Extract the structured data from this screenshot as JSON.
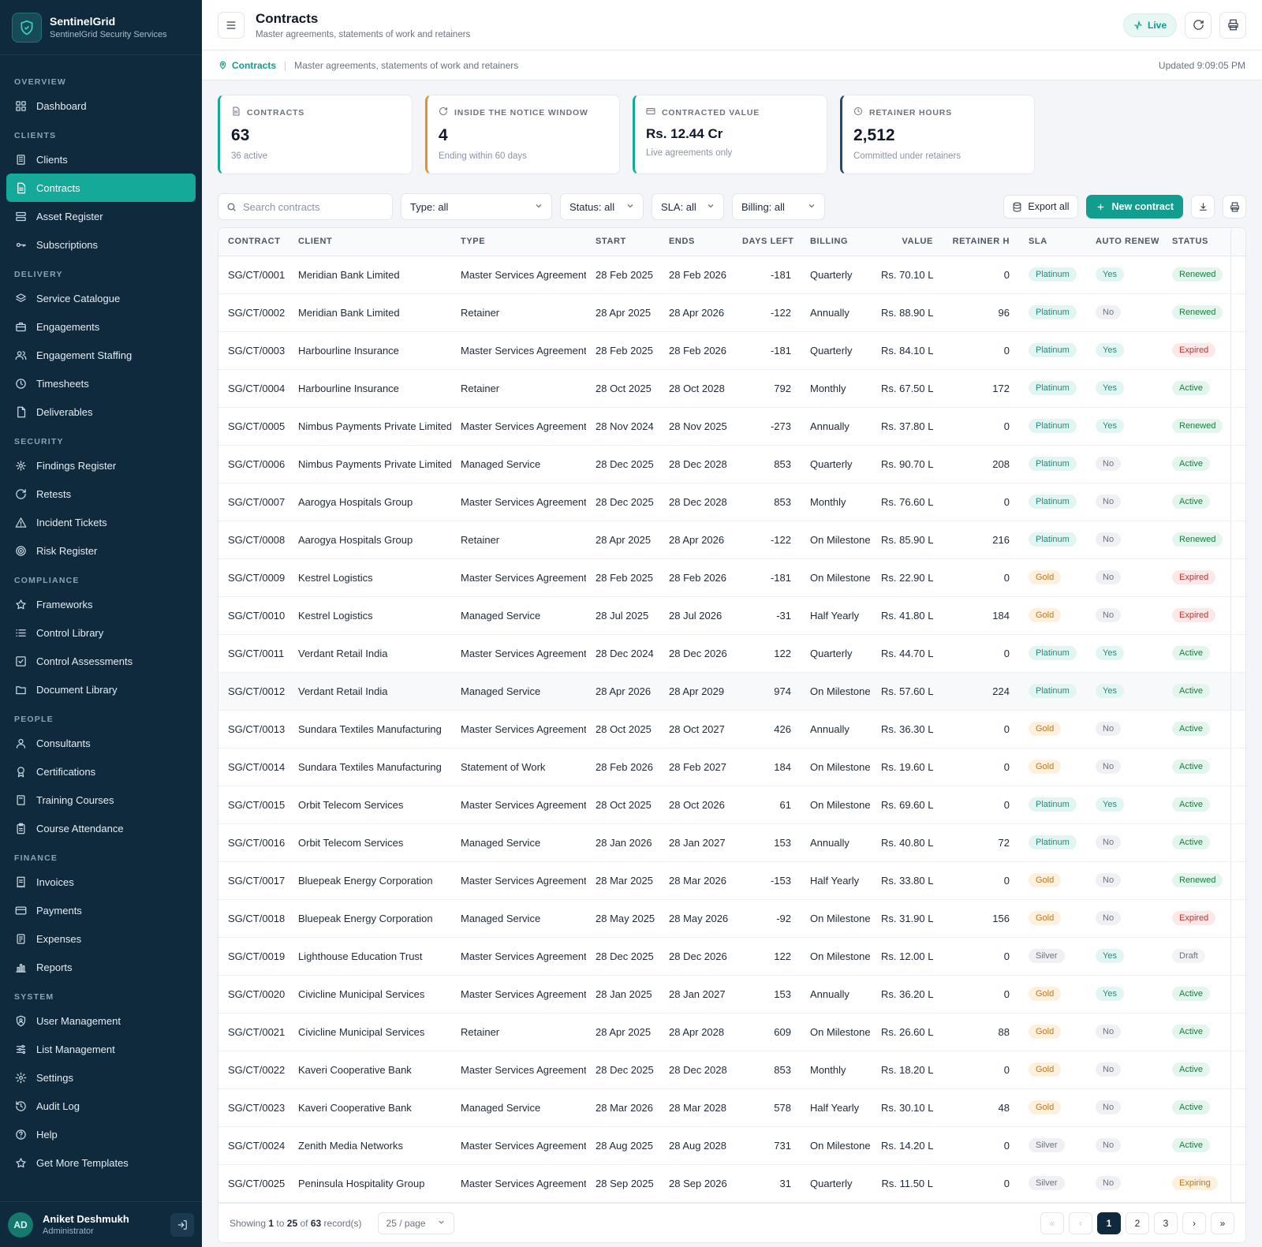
{
  "brand": {
    "name": "SentinelGrid",
    "subtitle": "SentinelGrid Security Services"
  },
  "sidebar": {
    "sections": [
      {
        "label": "OVERVIEW",
        "items": [
          {
            "label": "Dashboard",
            "icon": "dashboard-icon"
          }
        ]
      },
      {
        "label": "CLIENTS",
        "items": [
          {
            "label": "Clients",
            "icon": "building-icon"
          },
          {
            "label": "Contracts",
            "icon": "document-icon",
            "active": true
          },
          {
            "label": "Asset Register",
            "icon": "server-icon"
          },
          {
            "label": "Subscriptions",
            "icon": "key-icon"
          }
        ]
      },
      {
        "label": "DELIVERY",
        "items": [
          {
            "label": "Service Catalogue",
            "icon": "layers-icon"
          },
          {
            "label": "Engagements",
            "icon": "briefcase-icon"
          },
          {
            "label": "Engagement Staffing",
            "icon": "users-icon"
          },
          {
            "label": "Timesheets",
            "icon": "clock-icon"
          },
          {
            "label": "Deliverables",
            "icon": "file-icon"
          }
        ]
      },
      {
        "label": "SECURITY",
        "items": [
          {
            "label": "Findings Register",
            "icon": "bug-icon"
          },
          {
            "label": "Retests",
            "icon": "refresh-icon"
          },
          {
            "label": "Incident Tickets",
            "icon": "alert-icon"
          },
          {
            "label": "Risk Register",
            "icon": "target-icon"
          }
        ]
      },
      {
        "label": "COMPLIANCE",
        "items": [
          {
            "label": "Frameworks",
            "icon": "star-icon"
          },
          {
            "label": "Control Library",
            "icon": "list-icon"
          },
          {
            "label": "Control Assessments",
            "icon": "check-square-icon"
          },
          {
            "label": "Document Library",
            "icon": "folder-icon"
          }
        ]
      },
      {
        "label": "PEOPLE",
        "items": [
          {
            "label": "Consultants",
            "icon": "user-icon"
          },
          {
            "label": "Certifications",
            "icon": "award-icon"
          },
          {
            "label": "Training Courses",
            "icon": "book-icon"
          },
          {
            "label": "Course Attendance",
            "icon": "clipboard-icon"
          }
        ]
      },
      {
        "label": "FINANCE",
        "items": [
          {
            "label": "Invoices",
            "icon": "receipt-icon"
          },
          {
            "label": "Payments",
            "icon": "card-icon"
          },
          {
            "label": "Expenses",
            "icon": "wallet-icon"
          },
          {
            "label": "Reports",
            "icon": "bar-chart-icon"
          }
        ]
      },
      {
        "label": "SYSTEM",
        "items": [
          {
            "label": "User Management",
            "icon": "user-shield-icon"
          },
          {
            "label": "List Management",
            "icon": "sliders-icon"
          },
          {
            "label": "Settings",
            "icon": "gear-icon"
          },
          {
            "label": "Audit Log",
            "icon": "history-icon"
          },
          {
            "label": "Help",
            "icon": "help-icon"
          },
          {
            "label": "Get More Templates",
            "icon": "star-icon"
          }
        ]
      }
    ]
  },
  "user": {
    "initials": "AD",
    "name": "Aniket Deshmukh",
    "role": "Administrator"
  },
  "header": {
    "title": "Contracts",
    "subtitle": "Master agreements, statements of work and retainers",
    "live_label": "Live"
  },
  "breadcrumb": {
    "current": "Contracts",
    "description": "Master agreements, statements of work and retainers",
    "updated": "Updated 9:09:05 PM"
  },
  "cards": [
    {
      "label": "CONTRACTS",
      "value": "63",
      "sub": "36 active",
      "icon": "document-icon",
      "accent": "#15a99a"
    },
    {
      "label": "INSIDE THE NOTICE WINDOW",
      "value": "4",
      "sub": "Ending within 60 days",
      "icon": "refresh-icon",
      "accent": "#e0932b"
    },
    {
      "label": "CONTRACTED VALUE",
      "value": "Rs. 12.44 Cr",
      "sub": "Live agreements only",
      "icon": "card-icon",
      "accent": "#15a99a"
    },
    {
      "label": "RETAINER HOURS",
      "value": "2,512",
      "sub": "Committed under retainers",
      "icon": "clock-icon",
      "accent": "#1e4d74"
    }
  ],
  "filters": {
    "search_placeholder": "Search contracts",
    "type": "Type: all",
    "status": "Status: all",
    "sla": "SLA: all",
    "billing": "Billing: all",
    "export_label": "Export all",
    "new_label": "New contract"
  },
  "table": {
    "columns": [
      "CONTRACT",
      "CLIENT",
      "TYPE",
      "START",
      "ENDS",
      "DAYS LEFT",
      "BILLING",
      "VALUE",
      "RETAINER H",
      "SLA",
      "AUTO RENEW",
      "STATUS"
    ],
    "rows": [
      [
        "SG/CT/0001",
        "Meridian Bank Limited",
        "Master Services Agreement",
        "28 Feb 2025",
        "28 Feb 2026",
        "-181",
        "Quarterly",
        "Rs. 70.10 L",
        "0",
        "Platinum",
        "Yes",
        "Renewed"
      ],
      [
        "SG/CT/0002",
        "Meridian Bank Limited",
        "Retainer",
        "28 Apr 2025",
        "28 Apr 2026",
        "-122",
        "Annually",
        "Rs. 88.90 L",
        "96",
        "Platinum",
        "No",
        "Renewed"
      ],
      [
        "SG/CT/0003",
        "Harbourline Insurance",
        "Master Services Agreement",
        "28 Feb 2025",
        "28 Feb 2026",
        "-181",
        "Quarterly",
        "Rs. 84.10 L",
        "0",
        "Platinum",
        "Yes",
        "Expired"
      ],
      [
        "SG/CT/0004",
        "Harbourline Insurance",
        "Retainer",
        "28 Oct 2025",
        "28 Oct 2028",
        "792",
        "Monthly",
        "Rs. 67.50 L",
        "172",
        "Platinum",
        "Yes",
        "Active"
      ],
      [
        "SG/CT/0005",
        "Nimbus Payments Private Limited",
        "Master Services Agreement",
        "28 Nov 2024",
        "28 Nov 2025",
        "-273",
        "Annually",
        "Rs. 37.80 L",
        "0",
        "Platinum",
        "Yes",
        "Renewed"
      ],
      [
        "SG/CT/0006",
        "Nimbus Payments Private Limited",
        "Managed Service",
        "28 Dec 2025",
        "28 Dec 2028",
        "853",
        "Quarterly",
        "Rs. 90.70 L",
        "208",
        "Platinum",
        "No",
        "Active"
      ],
      [
        "SG/CT/0007",
        "Aarogya Hospitals Group",
        "Master Services Agreement",
        "28 Dec 2025",
        "28 Dec 2028",
        "853",
        "Monthly",
        "Rs. 76.60 L",
        "0",
        "Platinum",
        "No",
        "Active"
      ],
      [
        "SG/CT/0008",
        "Aarogya Hospitals Group",
        "Retainer",
        "28 Apr 2025",
        "28 Apr 2026",
        "-122",
        "On Milestone",
        "Rs. 85.90 L",
        "216",
        "Platinum",
        "No",
        "Renewed"
      ],
      [
        "SG/CT/0009",
        "Kestrel Logistics",
        "Master Services Agreement",
        "28 Feb 2025",
        "28 Feb 2026",
        "-181",
        "On Milestone",
        "Rs. 22.90 L",
        "0",
        "Gold",
        "No",
        "Expired"
      ],
      [
        "SG/CT/0010",
        "Kestrel Logistics",
        "Managed Service",
        "28 Jul 2025",
        "28 Jul 2026",
        "-31",
        "Half Yearly",
        "Rs. 41.80 L",
        "184",
        "Gold",
        "No",
        "Expired"
      ],
      [
        "SG/CT/0011",
        "Verdant Retail India",
        "Master Services Agreement",
        "28 Dec 2024",
        "28 Dec 2026",
        "122",
        "Quarterly",
        "Rs. 44.70 L",
        "0",
        "Platinum",
        "Yes",
        "Active"
      ],
      [
        "SG/CT/0012",
        "Verdant Retail India",
        "Managed Service",
        "28 Apr 2026",
        "28 Apr 2029",
        "974",
        "On Milestone",
        "Rs. 57.60 L",
        "224",
        "Platinum",
        "Yes",
        "Active"
      ],
      [
        "SG/CT/0013",
        "Sundara Textiles Manufacturing",
        "Master Services Agreement",
        "28 Oct 2025",
        "28 Oct 2027",
        "426",
        "Annually",
        "Rs. 36.30 L",
        "0",
        "Gold",
        "No",
        "Active"
      ],
      [
        "SG/CT/0014",
        "Sundara Textiles Manufacturing",
        "Statement of Work",
        "28 Feb 2026",
        "28 Feb 2027",
        "184",
        "On Milestone",
        "Rs. 19.60 L",
        "0",
        "Gold",
        "No",
        "Active"
      ],
      [
        "SG/CT/0015",
        "Orbit Telecom Services",
        "Master Services Agreement",
        "28 Oct 2025",
        "28 Oct 2026",
        "61",
        "On Milestone",
        "Rs. 69.60 L",
        "0",
        "Platinum",
        "Yes",
        "Active"
      ],
      [
        "SG/CT/0016",
        "Orbit Telecom Services",
        "Managed Service",
        "28 Jan 2026",
        "28 Jan 2027",
        "153",
        "Annually",
        "Rs. 40.80 L",
        "72",
        "Platinum",
        "No",
        "Active"
      ],
      [
        "SG/CT/0017",
        "Bluepeak Energy Corporation",
        "Master Services Agreement",
        "28 Mar 2025",
        "28 Mar 2026",
        "-153",
        "Half Yearly",
        "Rs. 33.80 L",
        "0",
        "Gold",
        "No",
        "Renewed"
      ],
      [
        "SG/CT/0018",
        "Bluepeak Energy Corporation",
        "Managed Service",
        "28 May 2025",
        "28 May 2026",
        "-92",
        "On Milestone",
        "Rs. 31.90 L",
        "156",
        "Gold",
        "No",
        "Expired"
      ],
      [
        "SG/CT/0019",
        "Lighthouse Education Trust",
        "Master Services Agreement",
        "28 Dec 2025",
        "28 Dec 2026",
        "122",
        "On Milestone",
        "Rs. 12.00 L",
        "0",
        "Silver",
        "Yes",
        "Draft"
      ],
      [
        "SG/CT/0020",
        "Civicline Municipal Services",
        "Master Services Agreement",
        "28 Jan 2025",
        "28 Jan 2027",
        "153",
        "Annually",
        "Rs. 36.20 L",
        "0",
        "Gold",
        "Yes",
        "Active"
      ],
      [
        "SG/CT/0021",
        "Civicline Municipal Services",
        "Retainer",
        "28 Apr 2025",
        "28 Apr 2028",
        "609",
        "On Milestone",
        "Rs. 26.60 L",
        "88",
        "Gold",
        "No",
        "Active"
      ],
      [
        "SG/CT/0022",
        "Kaveri Cooperative Bank",
        "Master Services Agreement",
        "28 Dec 2025",
        "28 Dec 2028",
        "853",
        "Monthly",
        "Rs. 18.20 L",
        "0",
        "Gold",
        "No",
        "Active"
      ],
      [
        "SG/CT/0023",
        "Kaveri Cooperative Bank",
        "Managed Service",
        "28 Mar 2026",
        "28 Mar 2028",
        "578",
        "Half Yearly",
        "Rs. 30.10 L",
        "48",
        "Gold",
        "No",
        "Active"
      ],
      [
        "SG/CT/0024",
        "Zenith Media Networks",
        "Master Services Agreement",
        "28 Aug 2025",
        "28 Aug 2028",
        "731",
        "On Milestone",
        "Rs. 14.20 L",
        "0",
        "Silver",
        "No",
        "Active"
      ],
      [
        "SG/CT/0025",
        "Peninsula Hospitality Group",
        "Master Services Agreement",
        "28 Sep 2025",
        "28 Sep 2026",
        "31",
        "Quarterly",
        "Rs. 11.50 L",
        "0",
        "Silver",
        "No",
        "Expiring"
      ]
    ]
  },
  "footer": {
    "showing_prefix": "Showing",
    "from": "1",
    "to_word": "to",
    "to": "25",
    "of_word": "of",
    "total": "63",
    "suffix": "record(s)",
    "per_page": "25 / page",
    "pages": [
      "1",
      "2",
      "3"
    ]
  }
}
